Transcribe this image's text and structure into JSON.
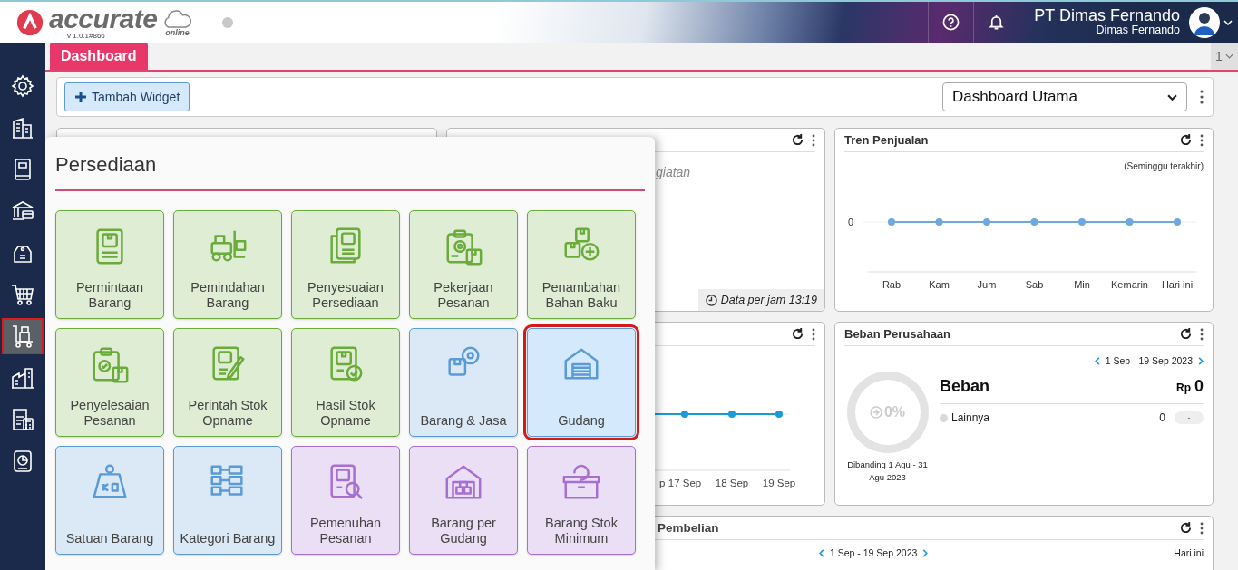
{
  "header": {
    "brand": "accurate",
    "brand_sub": "online",
    "version": "v 1.0.1#866",
    "company": "PT Dimas Fernando",
    "user": "Dimas Fernando"
  },
  "sidebar": {
    "items": [
      {
        "selected": false
      },
      {
        "selected": false
      },
      {
        "selected": false
      },
      {
        "selected": false
      },
      {
        "selected": false
      },
      {
        "selected": false
      },
      {
        "selected": true
      },
      {
        "selected": false
      },
      {
        "selected": false
      },
      {
        "selected": false
      }
    ]
  },
  "tabs": [
    {
      "label": "Dashboard",
      "selected": true
    }
  ],
  "page_switch": {
    "value": "1"
  },
  "toolbar": {
    "add_button": "Tambah Widget",
    "dashboard_select": "Dashboard Utama"
  },
  "widgets": {
    "activity": {
      "message": "giatan",
      "footer": "Data per jam 13:19"
    },
    "sales_trend": {
      "title": "Tren Penjualan",
      "note": "(Seminggu terakhir)",
      "y_label": "0",
      "x_labels": [
        "Rab",
        "Kam",
        "Jum",
        "Sab",
        "Min",
        "Kemarin",
        "Hari ini"
      ]
    },
    "daily_chart": {
      "x_labels": [
        "p",
        "17 Sep",
        "18 Sep",
        "19 Sep"
      ]
    },
    "expenses": {
      "title": "Beban Perusahaan",
      "period": "1 Sep - 19 Sep 2023",
      "percent": "0%",
      "compare": "Dibanding 1 Agu - 31 Agu 2023",
      "heading": "Beban",
      "currency": "Rp",
      "total": "0",
      "legend": [
        {
          "label": "Lainnya",
          "value": "0",
          "change": "-",
          "color": "#d9d9d9"
        }
      ]
    },
    "purchases": {
      "title": "Pembelian",
      "period": "1 Sep - 19 Sep 2023",
      "range": "Hari ini"
    }
  },
  "popup": {
    "title": "Persediaan",
    "tiles": [
      {
        "label": "Permintaan Barang",
        "color": "#6aab3a",
        "selected": false
      },
      {
        "label": "Pemindahan Barang",
        "color": "#6aab3a",
        "selected": false
      },
      {
        "label": "Penyesuaian Persediaan",
        "color": "#6aab3a",
        "selected": false
      },
      {
        "label": "Pekerjaan Pesanan",
        "color": "#6aab3a",
        "selected": false
      },
      {
        "label": "Penambahan Bahan Baku",
        "color": "#6aab3a",
        "selected": false
      },
      {
        "label": "Penyelesaian Pesanan",
        "color": "#6aab3a",
        "selected": false
      },
      {
        "label": "Perintah Stok Opname",
        "color": "#6aab3a",
        "selected": false
      },
      {
        "label": "Hasil Stok Opname",
        "color": "#6aab3a",
        "selected": false
      },
      {
        "label": "Barang & Jasa",
        "color": "#5b9bd5",
        "selected": false
      },
      {
        "label": "Gudang",
        "color": "#5b9bd5",
        "selected": true
      },
      {
        "label": "Satuan Barang",
        "color": "#5b9bd5",
        "selected": false
      },
      {
        "label": "Kategori Barang",
        "color": "#5b9bd5",
        "selected": false
      },
      {
        "label": "Pemenuhan Pesanan",
        "color": "#a66fd0",
        "selected": false
      },
      {
        "label": "Barang per Gudang",
        "color": "#a66fd0",
        "selected": false
      },
      {
        "label": "Barang Stok Minimum",
        "color": "#a66fd0",
        "selected": false
      }
    ]
  }
}
